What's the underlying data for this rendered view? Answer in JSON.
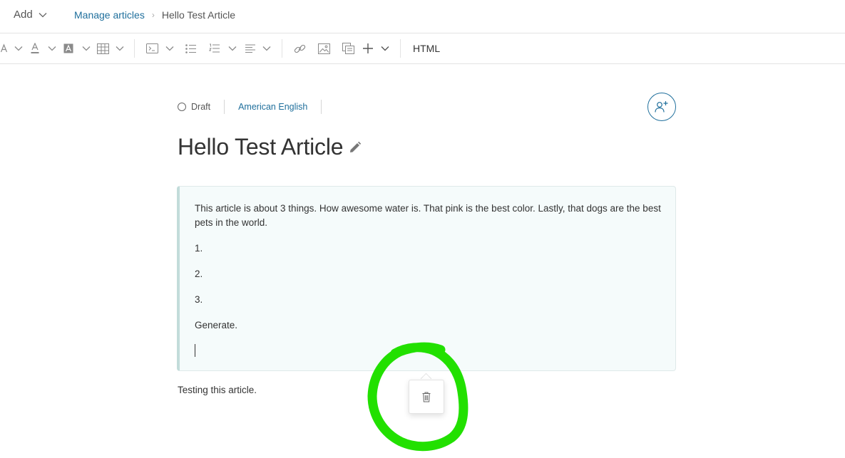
{
  "topbar": {
    "add_label": "Add",
    "breadcrumb": {
      "link": "Manage articles",
      "separator": "›",
      "current": "Hello Test Article"
    }
  },
  "toolbar": {
    "html_label": "HTML",
    "icons": [
      "font-size-icon",
      "font-color-icon",
      "highlight-color-icon",
      "table-icon",
      "code-block-icon",
      "bulleted-list-icon",
      "numbered-list-icon",
      "align-icon",
      "link-icon",
      "image-icon",
      "embed-icon",
      "insert-icon"
    ]
  },
  "meta": {
    "status": "Draft",
    "language": "American English"
  },
  "article": {
    "title": "Hello Test Article",
    "callout": {
      "paragraph": "This article is about 3 things. How awesome water is. That pink is the best color. Lastly, that dogs are the best pets in the world.",
      "item1": "1.",
      "item2": "2.",
      "item3": "3.",
      "item4": "Generate."
    },
    "body": "Testing this article."
  },
  "colors": {
    "link": "#1f6f9c",
    "callout_bg": "#f5fbfb",
    "callout_border": "#c2dcda",
    "annotation": "#22e000"
  }
}
